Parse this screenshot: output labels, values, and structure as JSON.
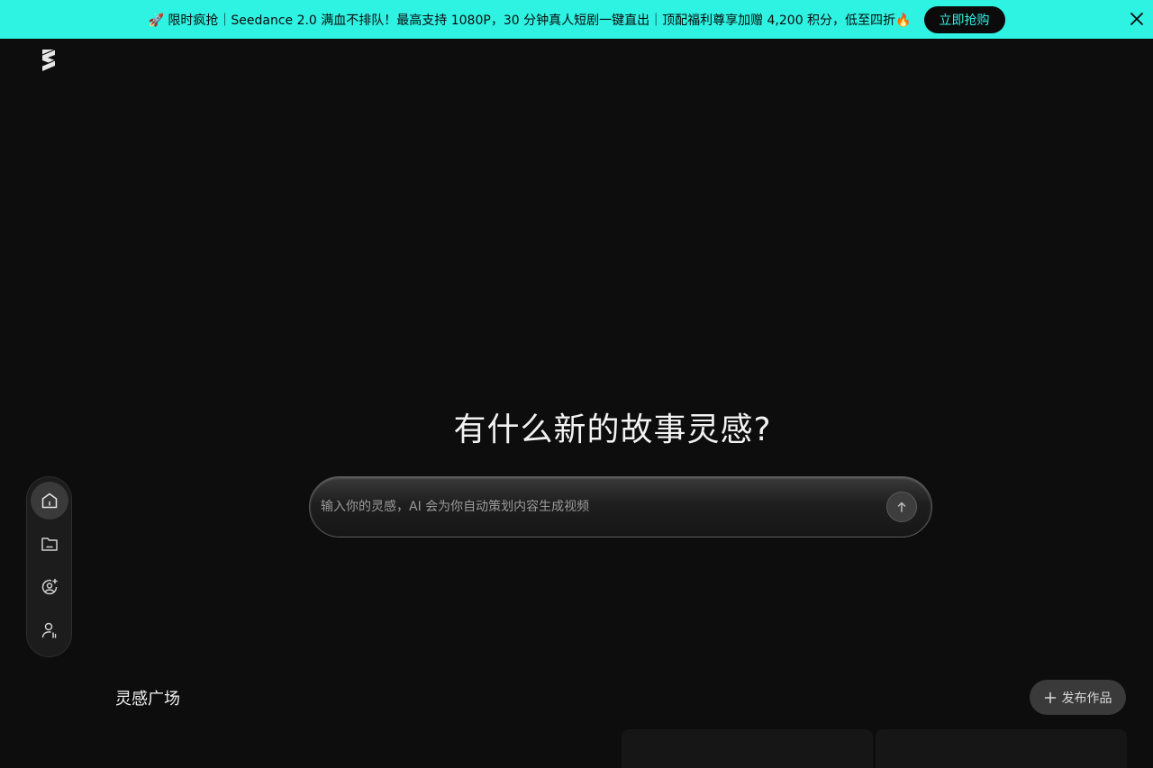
{
  "banner": {
    "text": "🚀 限时疯抢｜Seedance 2.0 满血不排队！最高支持 1080P，30 分钟真人短剧一键直出｜顶配福利尊享加赠 4,200 积分，低至四折🔥",
    "cta_label": "立即抢购",
    "bg_color": "#2ef2e2"
  },
  "main": {
    "headline": "有什么新的故事灵感?",
    "prompt_placeholder": "输入你的灵感，AI 会为你自动策划内容生成视频"
  },
  "sidebar": {
    "items": [
      {
        "icon": "home-icon",
        "active": true
      },
      {
        "icon": "folder-icon",
        "active": false
      },
      {
        "icon": "user-sparkle-icon",
        "active": false
      },
      {
        "icon": "user-account-icon",
        "active": false
      }
    ]
  },
  "gallery": {
    "title": "灵感广场",
    "publish_label": "发布作品"
  }
}
